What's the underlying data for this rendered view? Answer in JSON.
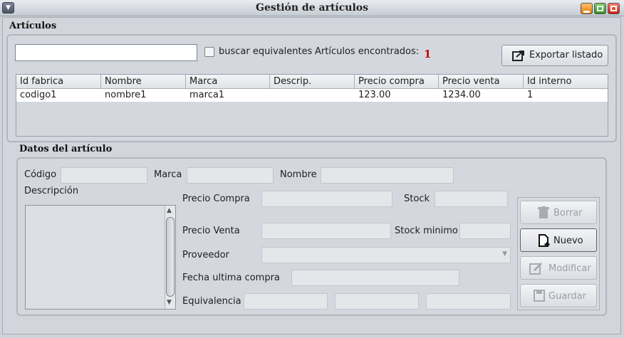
{
  "window": {
    "title": "Gestión de artículos"
  },
  "articulos": {
    "section_title": "Artículos",
    "search_value": "",
    "equivalentes_label": "buscar equivalentes",
    "found_label": "Artículos encontrados:",
    "found_count": "1",
    "export_label": "Exportar listado"
  },
  "table": {
    "headers": [
      "Id fabrica",
      "Nombre",
      "Marca",
      "Descrip.",
      "Precio compra",
      "Precio venta",
      "Id interno"
    ],
    "rows": [
      [
        "codigo1",
        "nombre1",
        "marca1",
        "",
        "123.00",
        "1234.00",
        "1"
      ]
    ]
  },
  "datos": {
    "section_title": "Datos del artículo",
    "codigo_label": "Código",
    "marca_label": "Marca",
    "nombre_label": "Nombre",
    "descripcion_label": "Descripción",
    "precio_compra_label": "Precio Compra",
    "stock_label": "Stock",
    "precio_venta_label": "Precio Venta",
    "stock_minimo_label": "Stock minimo",
    "proveedor_label": "Proveedor",
    "fecha_label": "Fecha ultima compra",
    "equivalencia_label": "Equivalencia"
  },
  "actions": {
    "borrar": "Borrar",
    "nuevo": "Nuevo",
    "modificar": "Modificar",
    "guardar": "Guardar"
  },
  "colors": {
    "count_red": "#cc0000"
  }
}
